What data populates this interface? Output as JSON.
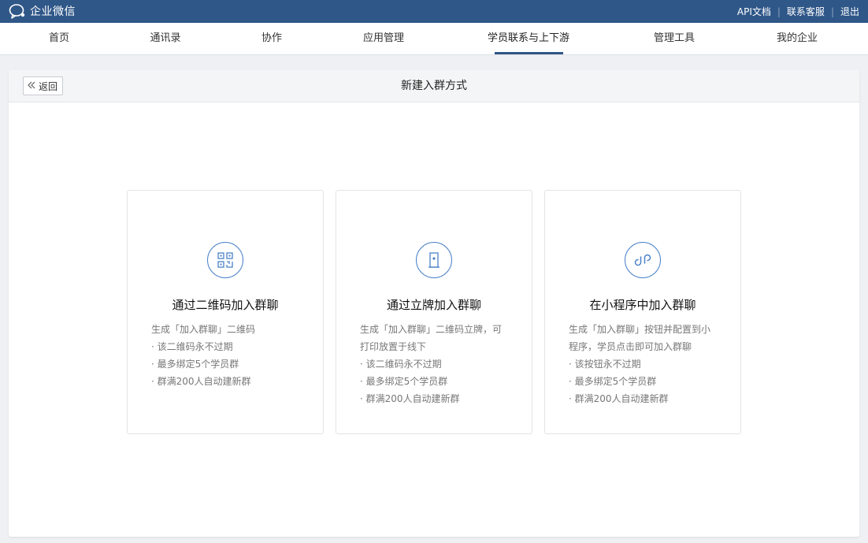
{
  "app": {
    "logo_text": "企业微信"
  },
  "top_links": [
    "API文档",
    "联系客服",
    "退出"
  ],
  "nav": {
    "items": [
      "首页",
      "通讯录",
      "协作",
      "应用管理",
      "学员联系与上下游",
      "管理工具",
      "我的企业"
    ],
    "active_index": 4
  },
  "panel": {
    "back_label": "返回",
    "title": "新建入群方式"
  },
  "cards": [
    {
      "icon": "qrcode-icon",
      "title": "通过二维码加入群聊",
      "lines": [
        "生成「加入群聊」二维码",
        "· 该二维码永不过期",
        "· 最多绑定5个学员群",
        "· 群满200人自动建新群"
      ]
    },
    {
      "icon": "door-sign-icon",
      "title": "通过立牌加入群聊",
      "lines": [
        "生成「加入群聊」二维码立牌，可打印放置于线下",
        "· 该二维码永不过期",
        "· 最多绑定5个学员群",
        "· 群满200人自动建新群"
      ]
    },
    {
      "icon": "mini-program-icon",
      "title": "在小程序中加入群聊",
      "lines": [
        "生成「加入群聊」按钮并配置到小程序，学员点击即可加入群聊",
        "· 该按钮永不过期",
        "· 最多绑定5个学员群",
        "· 群满200人自动建新群"
      ]
    }
  ],
  "colors": {
    "brand": "#2f5788",
    "accent": "#4b82c9"
  }
}
